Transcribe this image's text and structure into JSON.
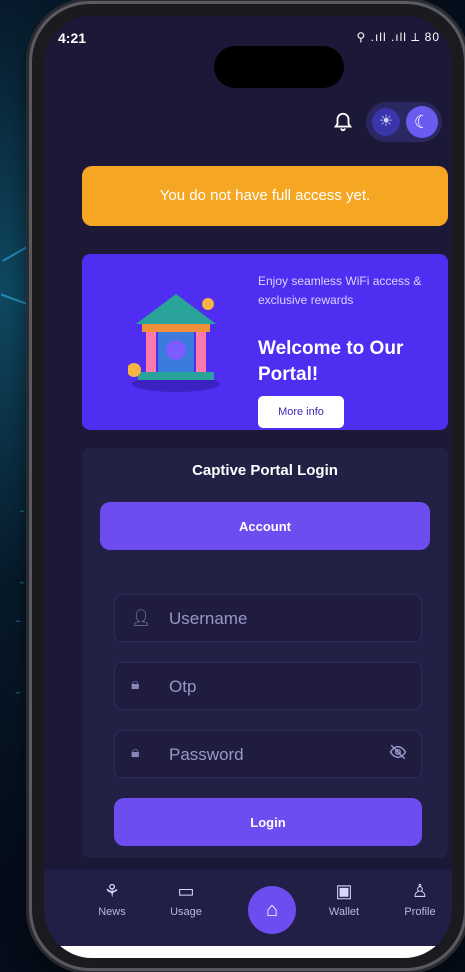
{
  "status_bar": {
    "time": "4:21",
    "indicators": "⚲ .ıll .ıll ⟂ 80"
  },
  "top_actions": {
    "bell_icon": "bell-icon",
    "sun_icon": "sun-icon",
    "moon_icon": "moon-icon"
  },
  "alert": {
    "text": "You do not have full access yet."
  },
  "banner": {
    "subtitle": "Enjoy seamless WiFi access & exclusive rewards",
    "title": "Welcome to Our Portal!",
    "button_label": "More info"
  },
  "login": {
    "title": "Captive Portal Login",
    "account_button": "Account",
    "username_placeholder": "Username",
    "otp_placeholder": "Otp",
    "password_placeholder": "Password",
    "login_button": "Login"
  },
  "bottom_nav": {
    "items": [
      {
        "label": "News",
        "icon": "news-icon"
      },
      {
        "label": "Usage",
        "icon": "usage-icon"
      },
      {
        "label": "",
        "icon": "home-icon"
      },
      {
        "label": "Wallet",
        "icon": "wallet-icon"
      },
      {
        "label": "Profile",
        "icon": "profile-icon"
      }
    ]
  },
  "colors": {
    "background": "#1b1838",
    "alert": "#f5a623",
    "banner": "#4f2ef2",
    "accent": "#6d4cf0"
  }
}
